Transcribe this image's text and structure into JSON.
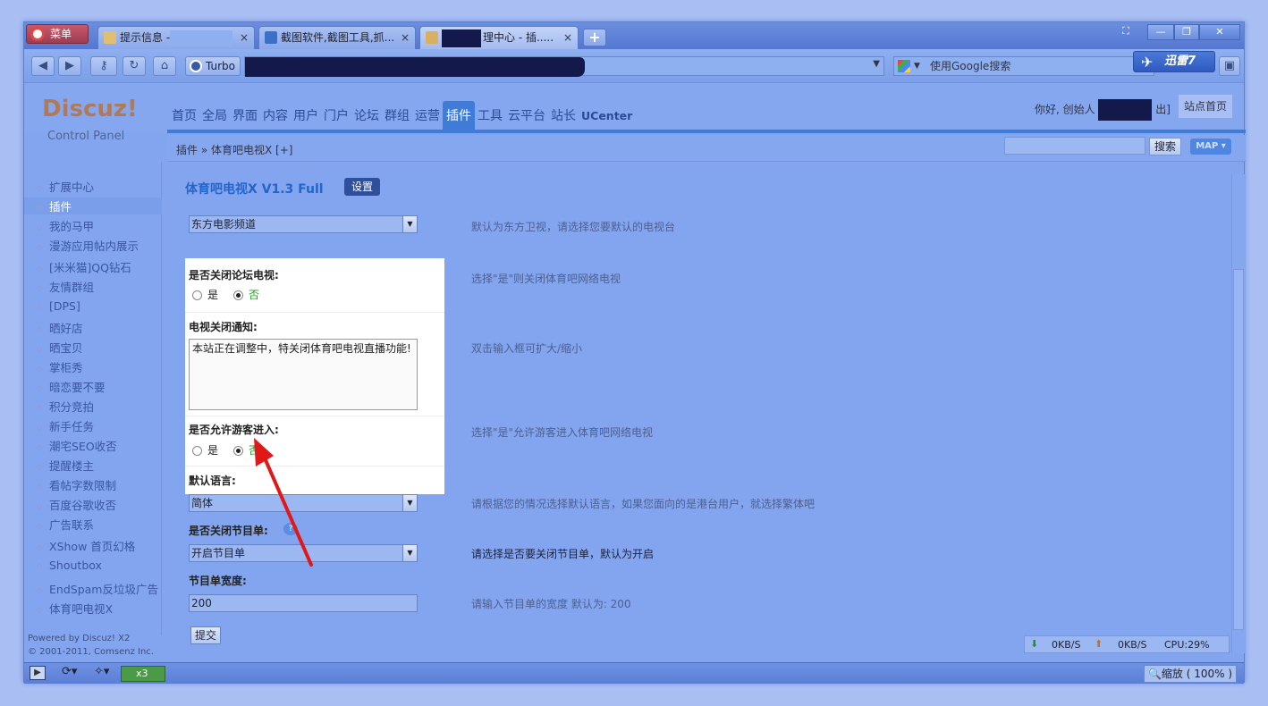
{
  "browser": {
    "menu_label": "菜单",
    "tabs": [
      {
        "label": "提示信息 -",
        "close": "×"
      },
      {
        "label": "截图软件,截图工具,抓...",
        "close": "×"
      },
      {
        "label": "理中心 - 插.....",
        "close": "×"
      }
    ],
    "new_tab": "+",
    "turbo_label": "Turbo",
    "search_placeholder": "使用Google搜索",
    "xunlei_label": "迅雷7"
  },
  "header": {
    "brand": "Discuz!",
    "brand_sub": "Control Panel",
    "nav": [
      "首页",
      "全局",
      "界面",
      "内容",
      "用户",
      "门户",
      "论坛",
      "群组",
      "运营",
      "插件",
      "工具",
      "云平台",
      "站长",
      "UCenter"
    ],
    "greeting": "你好, 创始人",
    "logout_tail": "出]",
    "site_home": "站点首页"
  },
  "breadcrumb": {
    "text": "插件 » 体育吧电视X  [+]",
    "search_button": "搜索",
    "map_button": "MAP ▾"
  },
  "sidebar": {
    "items": [
      "扩展中心",
      "插件",
      "我的马甲",
      "漫游应用帖内展示",
      "[米米猫]QQ钻石",
      "友情群组",
      "[DPS]",
      "晒好店",
      "晒宝贝",
      "掌柜秀",
      "暗恋要不要",
      "积分竞拍",
      "新手任务",
      "潮宅SEO收否",
      "提醒楼主",
      "看帖字数限制",
      "百度谷歌收否",
      "广告联系",
      "XShow 首页幻格",
      "Shoutbox",
      "EndSpam反垃圾广告",
      "体育吧电视X"
    ],
    "powered_by": "Powered by Discuz! X2",
    "copyright": "© 2001-2011, Comsenz Inc."
  },
  "plugin": {
    "title": "体育吧电视X V1.3 Full",
    "settings_button": "设置",
    "channel_select": "东方电影频道",
    "channel_hint": "默认为东方卫视，请选择您要默认的电视台",
    "close_tv_label": "是否关闭论坛电视:",
    "close_tv_hint": "选择\"是\"则关闭体育吧网络电视",
    "yes": "是",
    "no": "否",
    "notice_label": "电视关闭通知:",
    "notice_text": "本站正在调整中，特关闭体育吧电视直播功能!",
    "notice_hint": "双击输入框可扩大/缩小",
    "guest_label": "是否允许游客进入:",
    "guest_hint": "选择\"是\"允许游客进入体育吧网络电视",
    "lang_label": "默认语言:",
    "lang_select": "简体",
    "lang_hint": "请根据您的情况选择默认语言，如果您面向的是港台用户，就选择繁体吧",
    "menu_label": "是否关闭节目单:",
    "help_mark": "?",
    "menu_select": "开启节目单",
    "menu_hint": "请选择是否要关闭节目单，默认为开启",
    "width_label": "节目单宽度:",
    "width_value": "200",
    "width_hint": "请输入节目单的宽度 默认为: 200",
    "submit": "提交"
  },
  "status": {
    "down": "0KB/S",
    "up": "0KB/S",
    "cpu": "CPU:29%",
    "zoom": "缩放 ( 100% )",
    "counter": "x3"
  },
  "colors": {
    "annotation_arrow": "#e01818",
    "overlay_blue": "#83a5ef"
  }
}
